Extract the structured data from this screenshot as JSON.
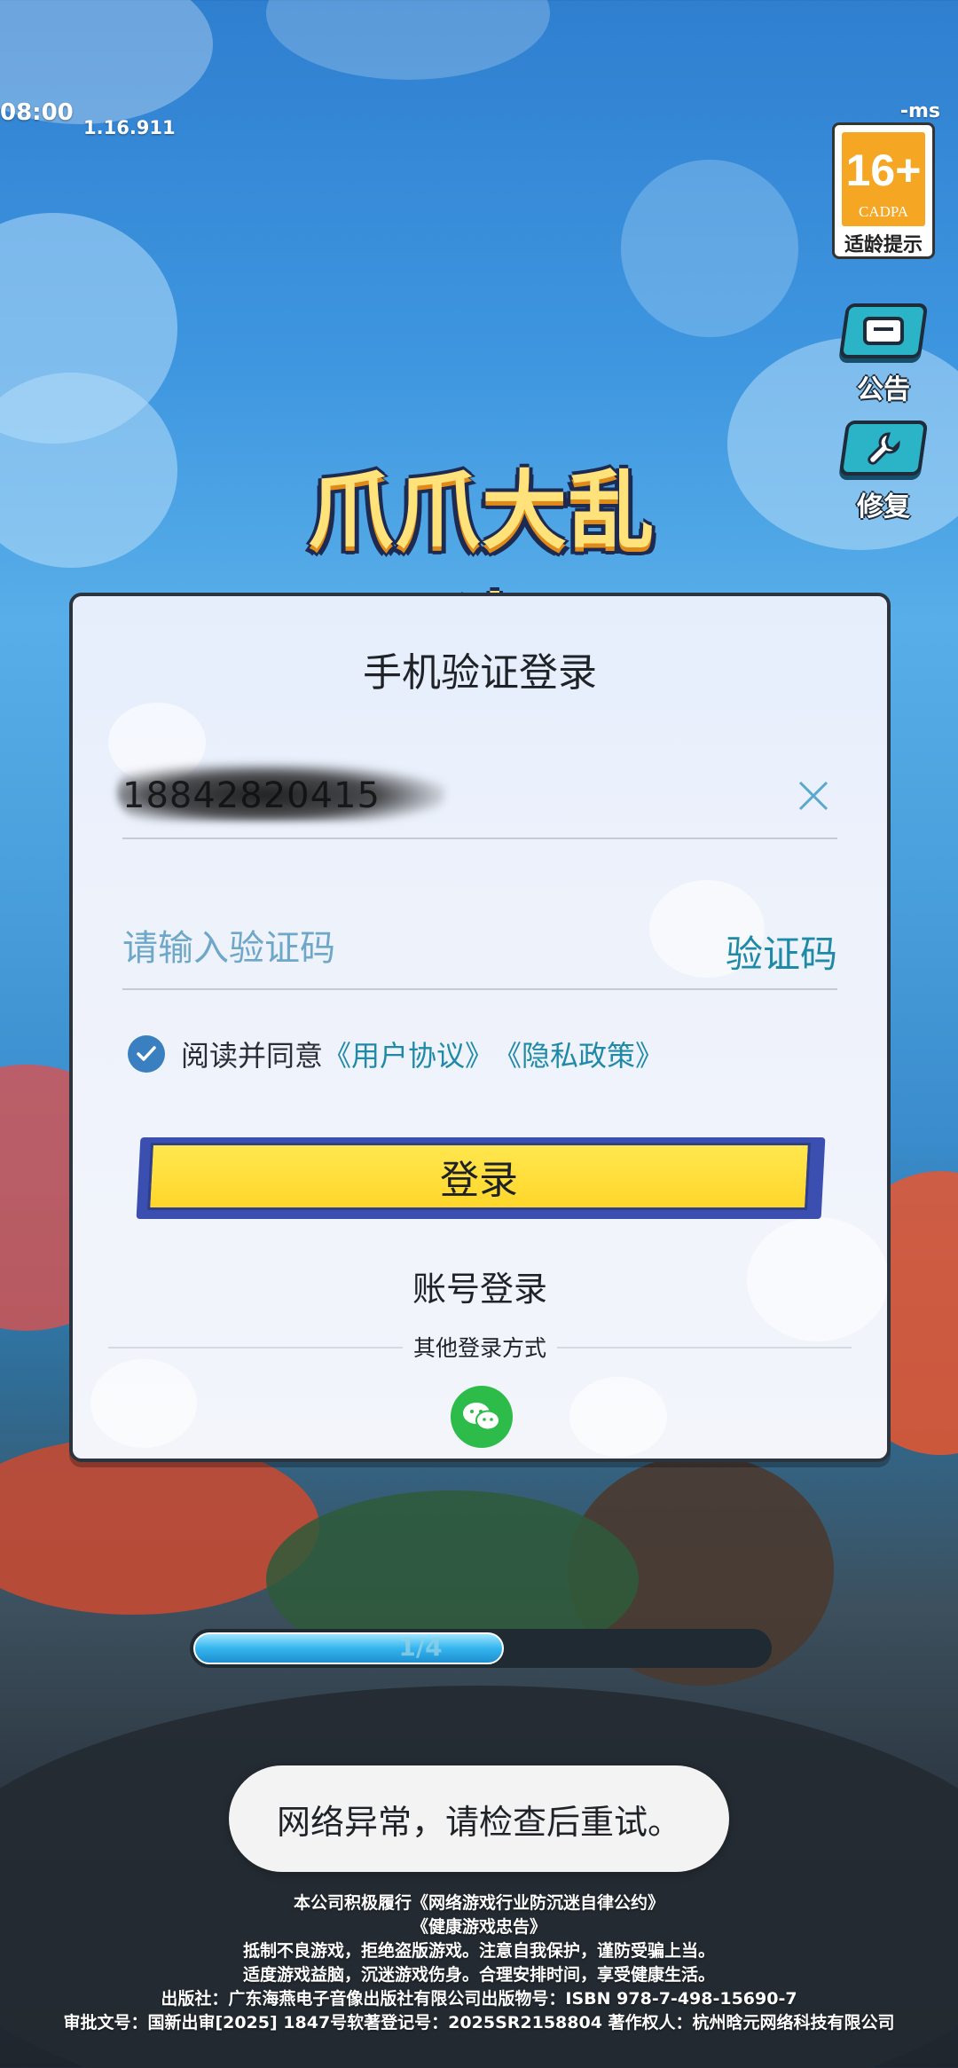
{
  "hud": {
    "time": "08:00",
    "version": "1.16.911",
    "ping": "-ms"
  },
  "age_badge": {
    "rating": "16+",
    "org": "CADPA",
    "label": "适龄提示"
  },
  "side_buttons": [
    {
      "label": "公告",
      "icon": "announcement-icon"
    },
    {
      "label": "修复",
      "icon": "wrench-icon"
    }
  ],
  "logo": {
    "text": "爪爪大乱斗"
  },
  "dialog": {
    "title": "手机验证登录",
    "phone_value": "18842820415",
    "code_placeholder": "请输入验证码",
    "send_code_label": "验证码",
    "agree_prefix": "阅读并同意",
    "user_agreement": "《用户协议》",
    "privacy_policy": "《隐私政策》",
    "agree_checked": true,
    "login_label": "登录",
    "account_login_label": "账号登录",
    "other_methods_label": "其他登录方式"
  },
  "progress": {
    "label": "1/4",
    "fraction": 0.54
  },
  "toast": {
    "message": "网络异常，请检查后重试。"
  },
  "footer": {
    "lines": [
      "本公司积极履行《网络游戏行业防沉迷自律公约》",
      "《健康游戏忠告》",
      "抵制不良游戏，拒绝盗版游戏。注意自我保护，谨防受骗上当。",
      "适度游戏益脑，沉迷游戏伤身。合理安排时间，享受健康生活。",
      "出版社：广东海燕电子音像出版社有限公司出版物号：ISBN 978-7-498-15690-7",
      "审批文号：国新出审[2025] 1847号软著登记号：2025SR2158804 著作权人：杭州晗元网络科技有限公司"
    ]
  },
  "colors": {
    "accent_teal": "#1f8aa8",
    "login_yellow": "#ffd62a",
    "checkbox_blue": "#3a7fc0",
    "wechat_green": "#2dbb4a"
  }
}
